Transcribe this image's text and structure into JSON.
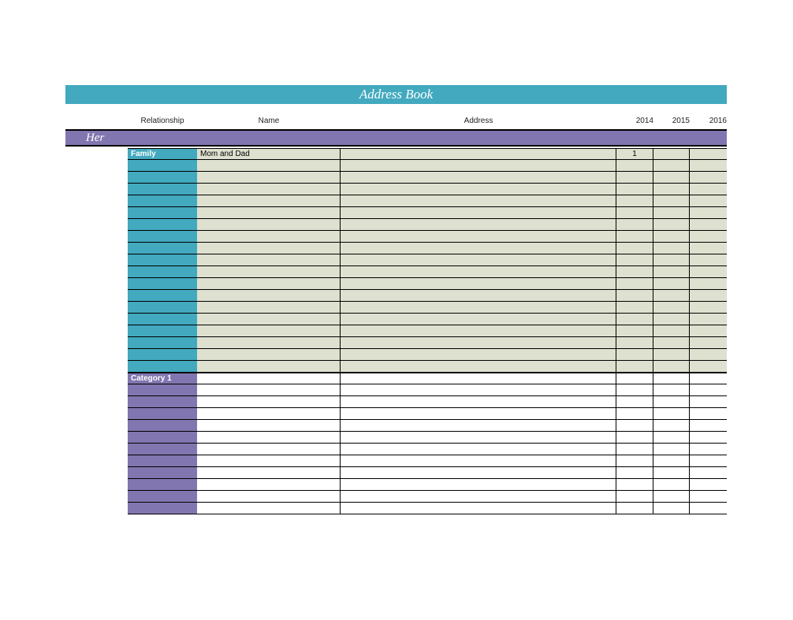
{
  "title": "Address Book",
  "columns": {
    "rel": "Relationship",
    "name": "Name",
    "addr": "Address",
    "y1": "2014",
    "y2": "2015",
    "y3": "2016"
  },
  "section_header": "Her",
  "groups": [
    {
      "id": "family",
      "label": "Family",
      "rows": [
        {
          "name": "Mom and Dad",
          "addr": "",
          "y1": "1",
          "y2": "",
          "y3": ""
        },
        {
          "name": "",
          "addr": "",
          "y1": "",
          "y2": "",
          "y3": ""
        },
        {
          "name": "",
          "addr": "",
          "y1": "",
          "y2": "",
          "y3": ""
        },
        {
          "name": "",
          "addr": "",
          "y1": "",
          "y2": "",
          "y3": ""
        },
        {
          "name": "",
          "addr": "",
          "y1": "",
          "y2": "",
          "y3": ""
        },
        {
          "name": "",
          "addr": "",
          "y1": "",
          "y2": "",
          "y3": ""
        },
        {
          "name": "",
          "addr": "",
          "y1": "",
          "y2": "",
          "y3": ""
        },
        {
          "name": "",
          "addr": "",
          "y1": "",
          "y2": "",
          "y3": ""
        },
        {
          "name": "",
          "addr": "",
          "y1": "",
          "y2": "",
          "y3": ""
        },
        {
          "name": "",
          "addr": "",
          "y1": "",
          "y2": "",
          "y3": ""
        },
        {
          "name": "",
          "addr": "",
          "y1": "",
          "y2": "",
          "y3": ""
        },
        {
          "name": "",
          "addr": "",
          "y1": "",
          "y2": "",
          "y3": ""
        },
        {
          "name": "",
          "addr": "",
          "y1": "",
          "y2": "",
          "y3": ""
        },
        {
          "name": "",
          "addr": "",
          "y1": "",
          "y2": "",
          "y3": ""
        },
        {
          "name": "",
          "addr": "",
          "y1": "",
          "y2": "",
          "y3": ""
        },
        {
          "name": "",
          "addr": "",
          "y1": "",
          "y2": "",
          "y3": ""
        },
        {
          "name": "",
          "addr": "",
          "y1": "",
          "y2": "",
          "y3": ""
        },
        {
          "name": "",
          "addr": "",
          "y1": "",
          "y2": "",
          "y3": ""
        },
        {
          "name": "",
          "addr": "",
          "y1": "",
          "y2": "",
          "y3": ""
        }
      ]
    },
    {
      "id": "cat1",
      "label": "Category 1",
      "rows": [
        {
          "name": "",
          "addr": "",
          "y1": "",
          "y2": "",
          "y3": ""
        },
        {
          "name": "",
          "addr": "",
          "y1": "",
          "y2": "",
          "y3": ""
        },
        {
          "name": "",
          "addr": "",
          "y1": "",
          "y2": "",
          "y3": ""
        },
        {
          "name": "",
          "addr": "",
          "y1": "",
          "y2": "",
          "y3": ""
        },
        {
          "name": "",
          "addr": "",
          "y1": "",
          "y2": "",
          "y3": ""
        },
        {
          "name": "",
          "addr": "",
          "y1": "",
          "y2": "",
          "y3": ""
        },
        {
          "name": "",
          "addr": "",
          "y1": "",
          "y2": "",
          "y3": ""
        },
        {
          "name": "",
          "addr": "",
          "y1": "",
          "y2": "",
          "y3": ""
        },
        {
          "name": "",
          "addr": "",
          "y1": "",
          "y2": "",
          "y3": ""
        },
        {
          "name": "",
          "addr": "",
          "y1": "",
          "y2": "",
          "y3": ""
        },
        {
          "name": "",
          "addr": "",
          "y1": "",
          "y2": "",
          "y3": ""
        },
        {
          "name": "",
          "addr": "",
          "y1": "",
          "y2": "",
          "y3": ""
        }
      ]
    }
  ]
}
